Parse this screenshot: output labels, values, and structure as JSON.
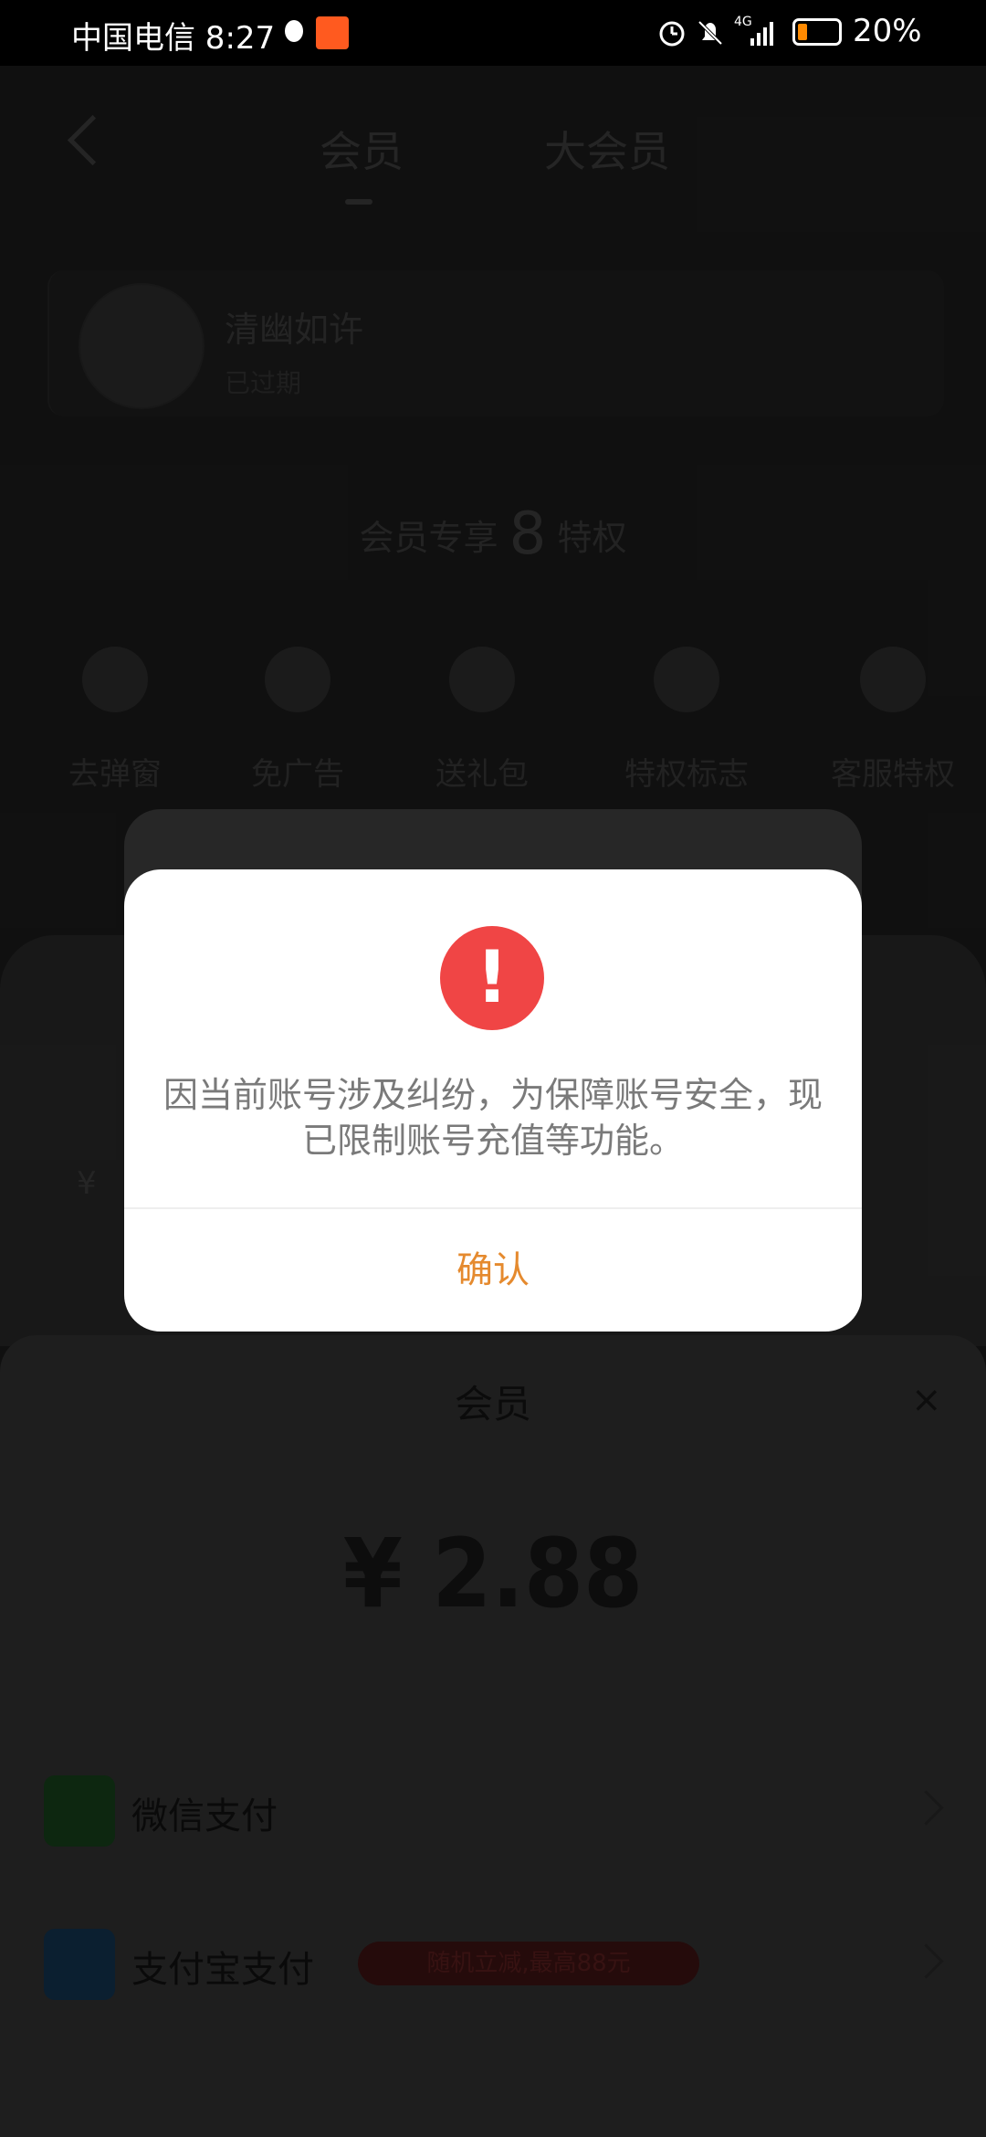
{
  "status_bar": {
    "carrier_time": "中国电信 8:27",
    "network": "4G",
    "battery": "20%"
  },
  "header": {
    "tabs": [
      "会员",
      "大会员"
    ]
  },
  "user": {
    "name": "清幽如许",
    "status": "已过期"
  },
  "privileges": {
    "title_prefix": "会员专享",
    "count": "8",
    "title_suffix": "特权",
    "items": [
      {
        "label": "去弹窗",
        "icon": "popup-icon"
      },
      {
        "label": "免广告",
        "icon": "no-ads-icon"
      },
      {
        "label": "送礼包",
        "icon": "gift-icon"
      },
      {
        "label": "特权标志",
        "icon": "crown-icon"
      },
      {
        "label": "客服特权",
        "icon": "headset-icon"
      }
    ]
  },
  "background_card": {
    "price_fragment": "¥"
  },
  "dialog": {
    "message": "因当前账号涉及纠纷，为保障账号安全，现已限制账号充值等功能。",
    "confirm_label": "确认",
    "accent_color": "#e58a2e",
    "warn_color": "#f04545"
  },
  "sheet": {
    "title": "会员",
    "close_symbol": "×",
    "price": "¥ 2.88",
    "payments": [
      {
        "label": "微信支付",
        "icon": "wechat-pay-icon",
        "color": "#1a8f2d"
      },
      {
        "label": "支付宝支付",
        "icon": "alipay-icon",
        "color": "#1677c8",
        "promo": "随机立减,最高88元"
      }
    ]
  }
}
